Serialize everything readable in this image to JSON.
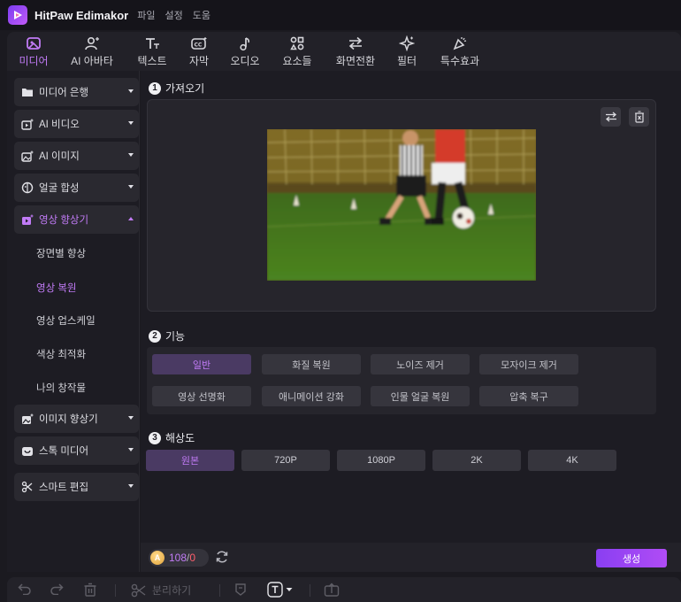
{
  "app": {
    "name": "HitPaw Edimakor",
    "menu": [
      "파일",
      "설정",
      "도움"
    ]
  },
  "toolbar": {
    "tabs": [
      {
        "label": "미디어",
        "icon": "media-icon",
        "active": true
      },
      {
        "label": "AI 아바타",
        "icon": "avatar-icon",
        "active": false
      },
      {
        "label": "텍스트",
        "icon": "text-icon",
        "active": false
      },
      {
        "label": "자막",
        "icon": "caption-icon",
        "active": false
      },
      {
        "label": "오디오",
        "icon": "audio-icon",
        "active": false
      },
      {
        "label": "요소들",
        "icon": "elements-icon",
        "active": false
      },
      {
        "label": "화면전환",
        "icon": "transition-icon",
        "active": false
      },
      {
        "label": "필터",
        "icon": "filter-icon",
        "active": false
      },
      {
        "label": "특수효과",
        "icon": "effects-icon",
        "active": false
      }
    ]
  },
  "sidebar": {
    "items": [
      {
        "label": "미디어 은행",
        "icon": "folder-icon"
      },
      {
        "label": "AI 비디오",
        "icon": "ai-video-icon"
      },
      {
        "label": "AI  이미지",
        "icon": "ai-image-icon"
      },
      {
        "label": "얼굴 합성",
        "icon": "face-swap-icon"
      },
      {
        "label": "영상 향상기",
        "icon": "video-enhancer-icon",
        "open": true
      },
      {
        "label": "이미지 향상기",
        "icon": "image-enhancer-icon"
      },
      {
        "label": "스톡 미디어",
        "icon": "stock-media-icon"
      },
      {
        "label": "스마트 편집",
        "icon": "smart-edit-icon"
      }
    ],
    "sub_items": [
      {
        "label": "장면별 향상",
        "active": false
      },
      {
        "label": "영상 복원",
        "active": true
      },
      {
        "label": "영상 업스케일",
        "active": false
      },
      {
        "label": "색상 최적화",
        "active": false
      },
      {
        "label": "나의 창작물",
        "active": false
      }
    ]
  },
  "main": {
    "import_title": "가져오기",
    "feature_title": "기능",
    "resolution_title": "해상도",
    "features": [
      "일반",
      "화질 복원",
      "노이즈 제거",
      "모자이크 제거",
      "영상 선명화",
      "애니메이션 강화",
      "인물 얼굴 복원",
      "압축 복구"
    ],
    "selected_feature": "일반",
    "resolutions": [
      "원본",
      "720P",
      "1080P",
      "2K",
      "4K"
    ],
    "selected_resolution": "원본"
  },
  "footer": {
    "credits_used": "108",
    "credits_sep": "/",
    "credits_total": "0",
    "generate_label": "생성"
  },
  "edit_bar": {
    "split_label": "분리하기"
  },
  "colors": {
    "accent": "#c17bf6",
    "button": "#9a44f3",
    "background": "#1b1a20"
  }
}
